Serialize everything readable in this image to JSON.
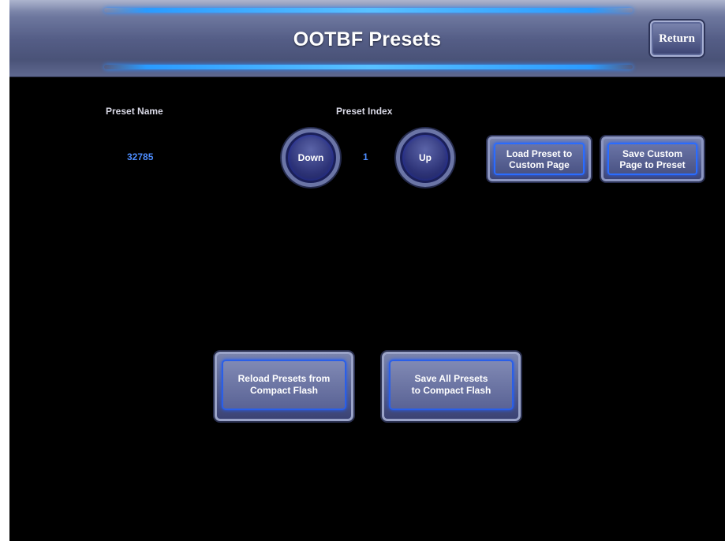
{
  "header": {
    "title": "OOTBF Presets",
    "return_label": "Return"
  },
  "preset": {
    "name_label": "Preset Name",
    "name_value": "32785",
    "index_label": "Preset Index",
    "index_value": "1",
    "down_label": "Down",
    "up_label": "Up"
  },
  "actions": {
    "load_label": "Load Preset to\nCustom Page",
    "save_custom_label": "Save Custom\nPage to Preset",
    "reload_label": "Reload Presets from\nCompact Flash",
    "save_all_label": "Save All Presets\nto Compact Flash"
  },
  "colors": {
    "background": "#000000",
    "header": "#545d86",
    "accent_glow": "#2a9bff",
    "value_text": "#4d8dff"
  }
}
